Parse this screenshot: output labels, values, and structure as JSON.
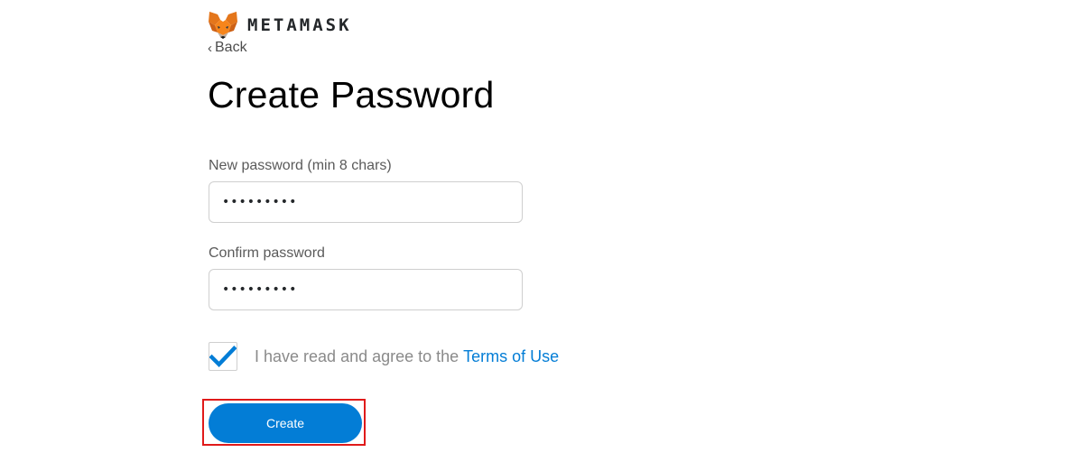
{
  "brand": {
    "name": "METAMASK",
    "logo_icon": "metamask-fox-icon"
  },
  "nav": {
    "back_chevron": "‹",
    "back_label": "Back"
  },
  "page": {
    "title": "Create Password"
  },
  "form": {
    "new_password": {
      "label": "New password (min 8 chars)",
      "value": "•••••••••"
    },
    "confirm_password": {
      "label": "Confirm password",
      "value": "•••••••••"
    },
    "terms": {
      "checked": true,
      "text": "I have read and agree to the",
      "link_label": "Terms of Use"
    },
    "submit_label": "Create"
  },
  "colors": {
    "accent": "#037dd6",
    "highlight": "#e01a1a",
    "fox_orange": "#e2761b"
  }
}
